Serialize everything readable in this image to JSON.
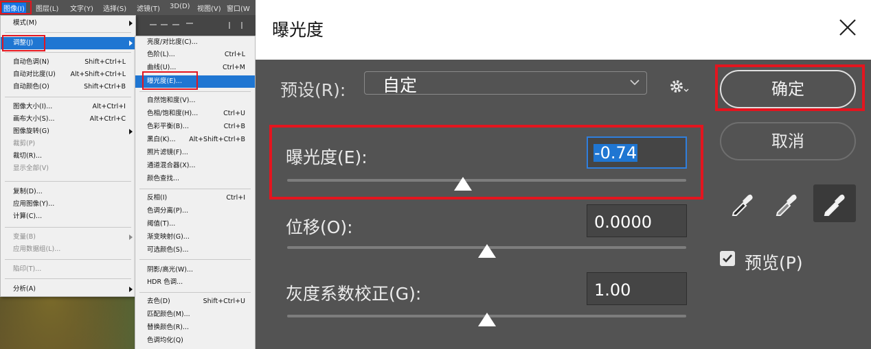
{
  "menubar": {
    "items": [
      "图像(I)",
      "图层(L)",
      "文字(Y)",
      "选择(S)",
      "滤镜(T)",
      "3D(D)",
      "视图(V)",
      "窗口(W"
    ]
  },
  "image_menu": {
    "items": [
      {
        "label": "模式(M)",
        "shortcut": "",
        "submenu": true
      },
      {
        "label": "调整(J)",
        "shortcut": "",
        "submenu": true,
        "highlighted": true
      },
      {
        "label": "自动色调(N)",
        "shortcut": "Shift+Ctrl+L"
      },
      {
        "label": "自动对比度(U)",
        "shortcut": "Alt+Shift+Ctrl+L"
      },
      {
        "label": "自动颜色(O)",
        "shortcut": "Shift+Ctrl+B"
      },
      {
        "label": "图像大小(I)...",
        "shortcut": "Alt+Ctrl+I"
      },
      {
        "label": "画布大小(S)...",
        "shortcut": "Alt+Ctrl+C"
      },
      {
        "label": "图像旋转(G)",
        "shortcut": "",
        "submenu": true
      },
      {
        "label": "裁剪(P)",
        "shortcut": "",
        "disabled": true
      },
      {
        "label": "裁切(R)...",
        "shortcut": ""
      },
      {
        "label": "显示全部(V)",
        "shortcut": "",
        "disabled": true
      },
      {
        "label": "复制(D)...",
        "shortcut": ""
      },
      {
        "label": "应用图像(Y)...",
        "shortcut": ""
      },
      {
        "label": "计算(C)...",
        "shortcut": ""
      },
      {
        "label": "变量(B)",
        "shortcut": "",
        "submenu": true,
        "disabled": true
      },
      {
        "label": "应用数据组(L)...",
        "shortcut": "",
        "disabled": true
      },
      {
        "label": "陷印(T)...",
        "shortcut": "",
        "disabled": true
      },
      {
        "label": "分析(A)",
        "shortcut": "",
        "submenu": true
      }
    ]
  },
  "adjust_menu": {
    "items": [
      {
        "label": "亮度/对比度(C)...",
        "shortcut": ""
      },
      {
        "label": "色阶(L)...",
        "shortcut": "Ctrl+L"
      },
      {
        "label": "曲线(U)...",
        "shortcut": "Ctrl+M"
      },
      {
        "label": "曝光度(E)...",
        "shortcut": "",
        "highlighted": true
      },
      {
        "label": "自然饱和度(V)...",
        "shortcut": ""
      },
      {
        "label": "色相/饱和度(H)...",
        "shortcut": "Ctrl+U"
      },
      {
        "label": "色彩平衡(B)...",
        "shortcut": "Ctrl+B"
      },
      {
        "label": "黑白(K)...",
        "shortcut": "Alt+Shift+Ctrl+B"
      },
      {
        "label": "照片滤镜(F)...",
        "shortcut": ""
      },
      {
        "label": "通道混合器(X)...",
        "shortcut": ""
      },
      {
        "label": "颜色查找...",
        "shortcut": ""
      },
      {
        "label": "反相(I)",
        "shortcut": "Ctrl+I"
      },
      {
        "label": "色调分离(P)...",
        "shortcut": ""
      },
      {
        "label": "阈值(T)...",
        "shortcut": ""
      },
      {
        "label": "渐变映射(G)...",
        "shortcut": ""
      },
      {
        "label": "可选颜色(S)...",
        "shortcut": ""
      },
      {
        "label": "阴影/高光(W)...",
        "shortcut": ""
      },
      {
        "label": "HDR 色调...",
        "shortcut": ""
      },
      {
        "label": "去色(D)",
        "shortcut": "Shift+Ctrl+U"
      },
      {
        "label": "匹配颜色(M)...",
        "shortcut": ""
      },
      {
        "label": "替换颜色(R)...",
        "shortcut": ""
      },
      {
        "label": "色调均化(Q)",
        "shortcut": ""
      }
    ]
  },
  "dialog": {
    "title": "曝光度",
    "preset_label": "预设(R):",
    "preset_value": "自定",
    "exposure_label": "曝光度(E):",
    "exposure_value": "-0.74",
    "exposure_slider_fraction": 0.44,
    "offset_label": "位移(O):",
    "offset_value": "0.0000",
    "offset_slider_fraction": 0.5,
    "gamma_label": "灰度系数校正(G):",
    "gamma_value": "1.00",
    "gamma_slider_fraction": 0.5,
    "ok_label": "确定",
    "cancel_label": "取消",
    "preview_label": "预览(P)",
    "preview_checked": true,
    "eyedroppers": [
      "black-point-eyedropper-icon",
      "gray-point-eyedropper-icon",
      "white-point-eyedropper-icon"
    ],
    "selected_eyedropper": 2
  },
  "colors": {
    "highlight_blue": "#1f76d2",
    "annotation_red": "#e3151f",
    "dialog_bg": "#535353"
  }
}
